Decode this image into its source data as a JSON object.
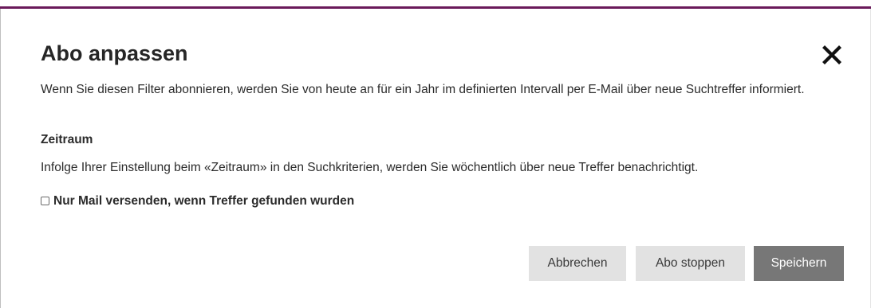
{
  "dialog": {
    "title": "Abo anpassen",
    "close_icon": "close-x-icon",
    "intro": "Wenn Sie diesen Filter abonnieren, werden Sie von heute an für ein Jahr im definierten Intervall per E-Mail über neue Suchtreffer informiert.",
    "period": {
      "heading": "Zeitraum",
      "text": "Infolge Ihrer Einstellung beim «Zeitraum» in den Suchkriterien, werden Sie wöchentlich über neue Treffer benachrichtigt."
    },
    "only_on_hits": {
      "label": "Nur Mail versenden, wenn Treffer gefunden wurden",
      "checked": false
    },
    "buttons": {
      "cancel": "Abbrechen",
      "stop": "Abo stoppen",
      "save": "Speichern"
    }
  },
  "colors": {
    "accent_border": "#6a1a5a",
    "secondary_button": "#e2e2e2",
    "primary_button": "#777777"
  }
}
